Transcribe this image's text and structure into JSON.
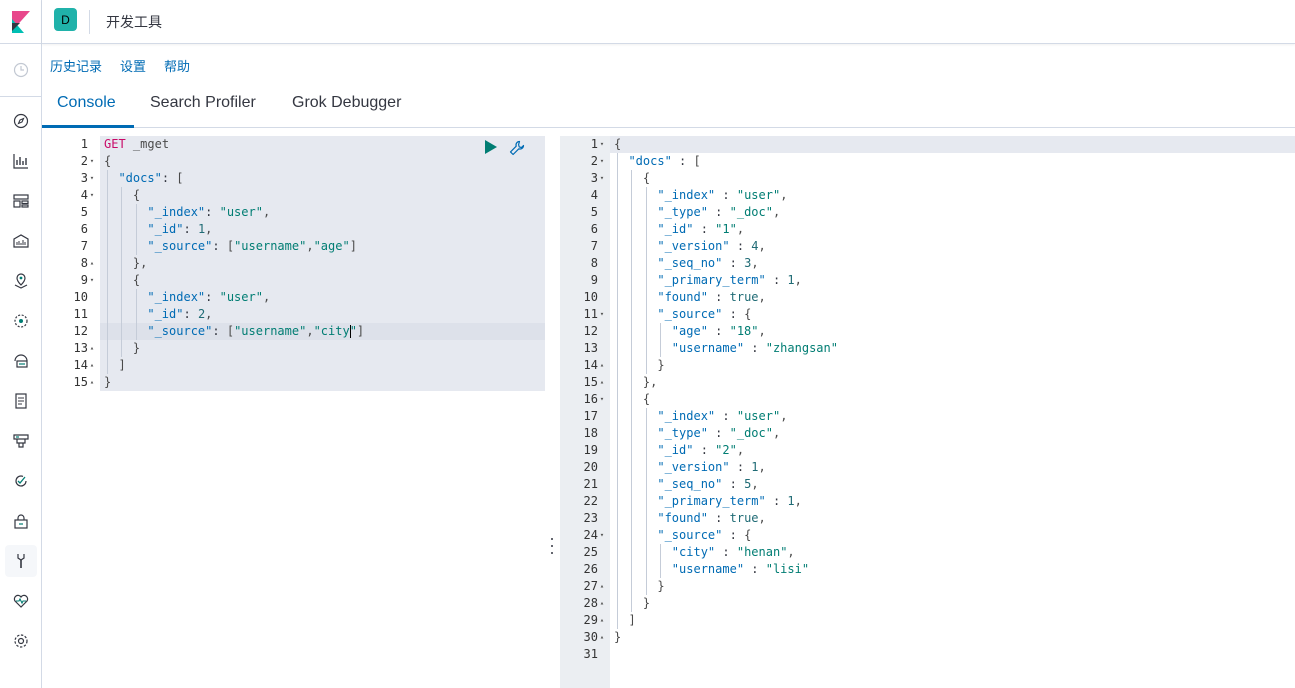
{
  "colors": {
    "accent": "#006bb4",
    "space_badge": "#20b2aa",
    "keyword": "#c80a68",
    "string": "#017d73",
    "logo_pink": "#e8478b",
    "logo_teal": "#00bfb3"
  },
  "header": {
    "space_initial": "D",
    "breadcrumb": "开发工具"
  },
  "top_menu": {
    "history": "历史记录",
    "settings": "设置",
    "help": "帮助"
  },
  "tabs": [
    "Console",
    "Search Profiler",
    "Grok Debugger"
  ],
  "nav_icons": [
    "clock-icon",
    "discover-icon",
    "visualize-icon",
    "dashboard-icon",
    "canvas-icon",
    "maps-icon",
    "ml-icon",
    "infrastructure-icon",
    "logs-icon",
    "apm-icon",
    "uptime-icon",
    "security-icon",
    "dev-tools-icon",
    "monitoring-icon",
    "management-icon"
  ],
  "request": {
    "lines": [
      "GET _mget",
      "{",
      "  \"docs\": [",
      "    {",
      "      \"_index\": \"user\",",
      "      \"_id\": 1,",
      "      \"_source\": [\"username\",\"age\"]",
      "    },",
      "    {",
      "      \"_index\": \"user\",",
      "      \"_id\": 2,",
      "      \"_source\": [\"username\",\"city\"]",
      "    }",
      "  ]",
      "}"
    ],
    "line_numbers": [
      "1",
      "2",
      "3",
      "4",
      "5",
      "6",
      "7",
      "8",
      "9",
      "10",
      "11",
      "12",
      "13",
      "14",
      "15"
    ],
    "folds": [
      "",
      "▾",
      "▾",
      "▾",
      "",
      "",
      "",
      "▴",
      "▾",
      "",
      "",
      "",
      "▴",
      "▴",
      "▴"
    ]
  },
  "response": {
    "lines": [
      "{",
      "  \"docs\" : [",
      "    {",
      "      \"_index\" : \"user\",",
      "      \"_type\" : \"_doc\",",
      "      \"_id\" : \"1\",",
      "      \"_version\" : 4,",
      "      \"_seq_no\" : 3,",
      "      \"_primary_term\" : 1,",
      "      \"found\" : true,",
      "      \"_source\" : {",
      "        \"age\" : \"18\",",
      "        \"username\" : \"zhangsan\"",
      "      }",
      "    },",
      "    {",
      "      \"_index\" : \"user\",",
      "      \"_type\" : \"_doc\",",
      "      \"_id\" : \"2\",",
      "      \"_version\" : 1,",
      "      \"_seq_no\" : 5,",
      "      \"_primary_term\" : 1,",
      "      \"found\" : true,",
      "      \"_source\" : {",
      "        \"city\" : \"henan\",",
      "        \"username\" : \"lisi\"",
      "      }",
      "    }",
      "  ]",
      "}",
      ""
    ],
    "line_numbers": [
      "1",
      "2",
      "3",
      "4",
      "5",
      "6",
      "7",
      "8",
      "9",
      "10",
      "11",
      "12",
      "13",
      "14",
      "15",
      "16",
      "17",
      "18",
      "19",
      "20",
      "21",
      "22",
      "23",
      "24",
      "25",
      "26",
      "27",
      "28",
      "29",
      "30",
      "31"
    ],
    "folds": [
      "▾",
      "▾",
      "▾",
      "",
      "",
      "",
      "",
      "",
      "",
      "",
      "▾",
      "",
      "",
      "▴",
      "▴",
      "▾",
      "",
      "",
      "",
      "",
      "",
      "",
      "",
      "▾",
      "",
      "",
      "▴",
      "▴",
      "▴",
      "▴",
      ""
    ]
  }
}
